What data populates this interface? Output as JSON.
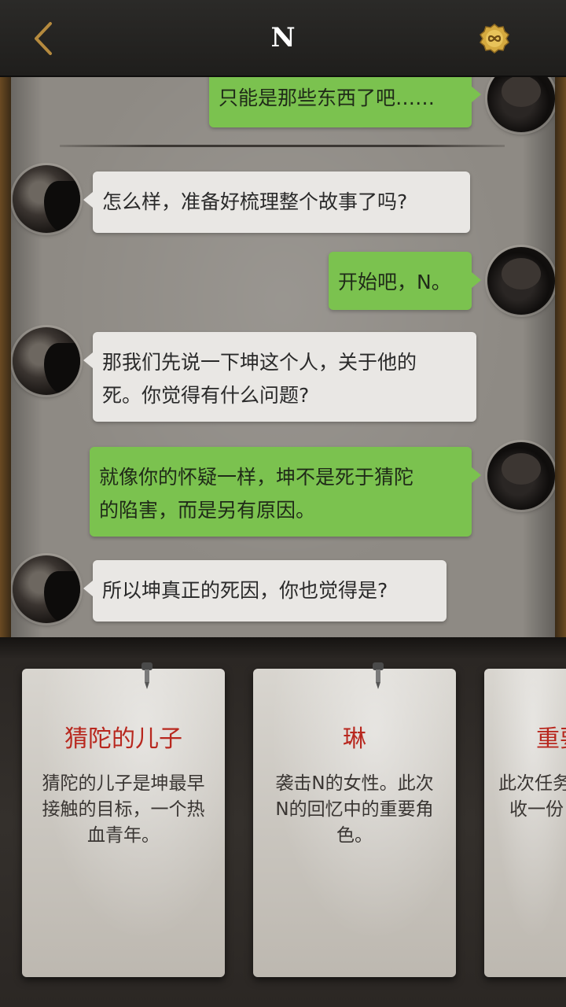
{
  "header": {
    "title": "N",
    "back_icon": "chevron-left-icon",
    "currency_icon": "infinity-coin-icon",
    "accent_color": "#b58a3e"
  },
  "chat": {
    "messages": [
      {
        "from": "me",
        "text": "只能是那些东西了吧……"
      },
      {
        "from": "n",
        "text": "怎么样，准备好梳理整个故事了吗?"
      },
      {
        "from": "me",
        "text": "开始吧，N。"
      },
      {
        "from": "n",
        "lines": [
          "那我们先说一下坤这个人，关于他的",
          "死。你觉得有什么问题?"
        ]
      },
      {
        "from": "me",
        "lines": [
          "就像你的怀疑一样，坤不是死于猜陀",
          "的陷害，而是另有原因。"
        ]
      },
      {
        "from": "n",
        "text": "所以坤真正的死因，你也觉得是?"
      }
    ]
  },
  "cards": [
    {
      "title": "猜陀的儿子",
      "lines": [
        "猜陀的儿子是坤最早",
        "接触的目标，一个热",
        "血青年。"
      ]
    },
    {
      "title": "琳",
      "lines": [
        "袭击N的女性。此次",
        "N的回忆中的重要角",
        "色。"
      ]
    },
    {
      "title": "重要",
      "lines": [
        "此次任务",
        "收一份"
      ]
    }
  ],
  "colors": {
    "my_bubble": "#7bc24f",
    "their_bubble": "#e9e7e4",
    "card_title": "#b8271e"
  }
}
